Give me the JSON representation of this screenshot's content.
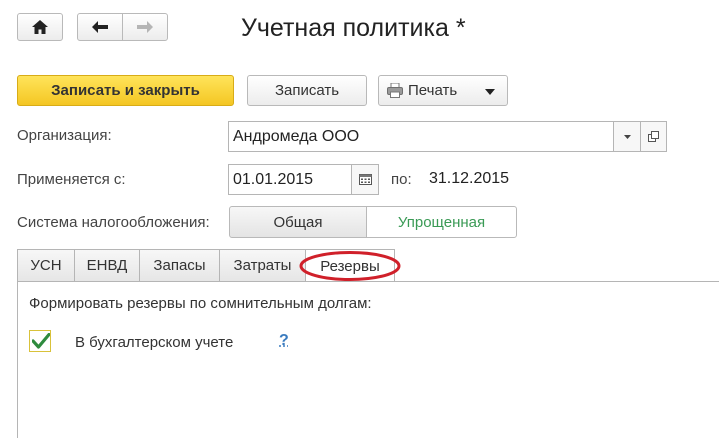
{
  "window": {
    "title": "Учетная политика *"
  },
  "nav": {
    "home_icon": "home-icon",
    "back_icon": "arrow-left-icon",
    "forward_icon": "arrow-right-icon"
  },
  "toolbar": {
    "save_close_label": "Записать и закрыть",
    "save_label": "Записать",
    "print_label": "Печать",
    "print_icon": "printer-icon",
    "dropdown_icon": "triangle-down-icon"
  },
  "form": {
    "organization_label": "Организация:",
    "organization_value": "Андромеда ООО",
    "applies_label": "Применяется с:",
    "date_from": "01.01.2015",
    "to_label": "по:",
    "date_to": "31.12.2015",
    "tax_system_label": "Система налогообложения:",
    "tax_options": [
      "Общая",
      "Упрощенная"
    ],
    "tax_selected": "Упрощенная"
  },
  "tabs": [
    "УСН",
    "ЕНВД",
    "Запасы",
    "Затраты",
    "Резервы"
  ],
  "active_tab": "Резервы",
  "panel": {
    "heading": "Формировать резервы по сомнительным долгам:",
    "checkbox_label": "В бухгалтерском учете",
    "checkbox_checked": true,
    "help_label": "?"
  },
  "colors": {
    "primary_button": "#f4c623",
    "selected_segment_text": "#3a9a55",
    "highlight_ellipse": "#d0202a",
    "help_link": "#3a7bbf",
    "checkbox_border": "#d9c23a",
    "checkmark": "#2e8b3e"
  }
}
